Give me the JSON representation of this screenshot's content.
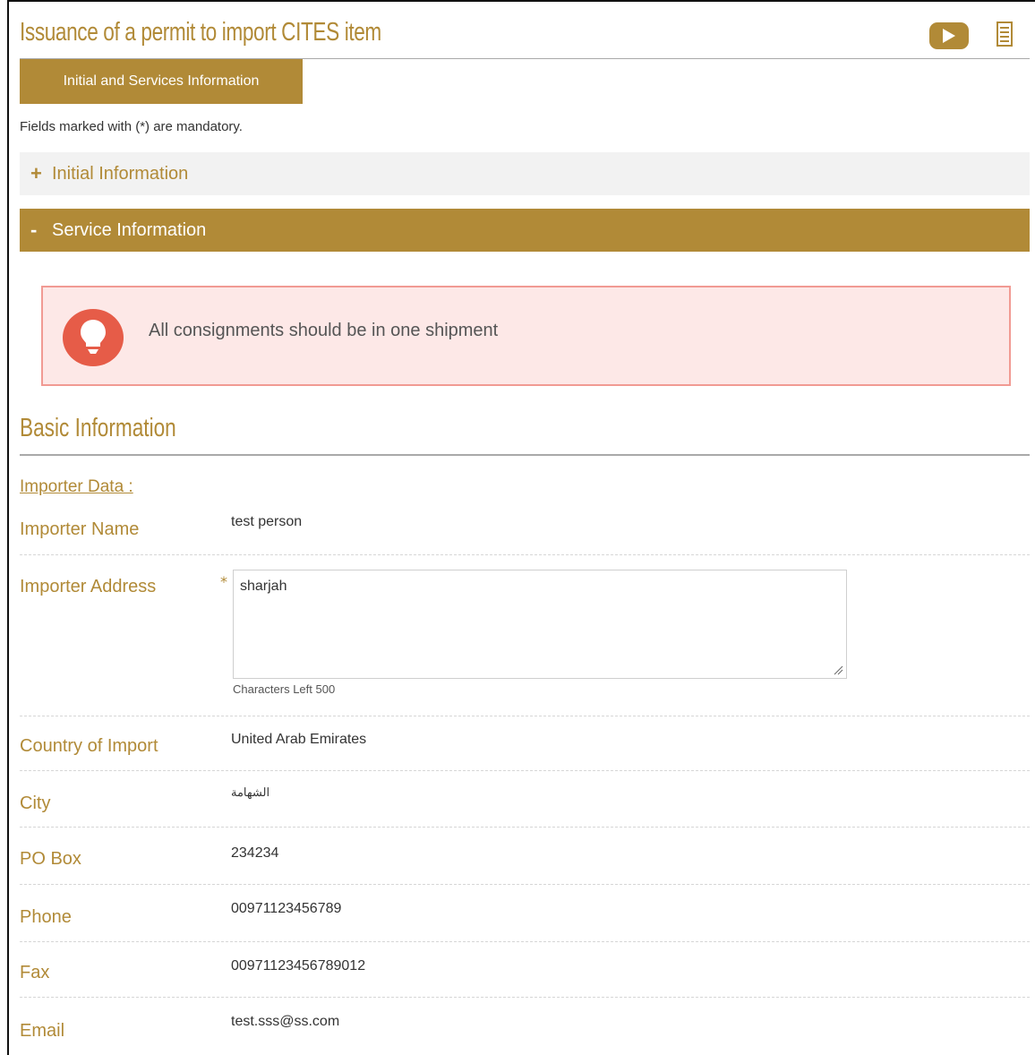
{
  "header": {
    "title": "Issuance of a permit to import CITES item",
    "icons": {
      "video": "play-video-icon",
      "document": "document-icon"
    }
  },
  "tabs": [
    {
      "label": "Initial and Services Information",
      "active": true
    }
  ],
  "form": {
    "mandatory_note": "Fields marked with (*) are mandatory."
  },
  "accordions": {
    "initial": {
      "sign": "+",
      "label": "Initial Information",
      "expanded": false
    },
    "service": {
      "sign": "-",
      "label": "Service Information",
      "expanded": true
    }
  },
  "notice": {
    "text": "All consignments should be in one shipment",
    "icon": "lightbulb-icon"
  },
  "basic_info": {
    "title": "Basic Information",
    "subheading": "Importer Data :",
    "fields": {
      "importer_name": {
        "label": "Importer Name",
        "value": "test person"
      },
      "importer_address": {
        "label": "Importer Address",
        "value": "sharjah",
        "required_mark": "*",
        "chars_left": "Characters Left 500"
      },
      "country": {
        "label": "Country of Import",
        "value": "United Arab Emirates"
      },
      "city": {
        "label": "City",
        "value": "الشهامة"
      },
      "po_box": {
        "label": "PO Box",
        "value": "234234"
      },
      "phone": {
        "label": "Phone",
        "value": "00971123456789"
      },
      "fax": {
        "label": "Fax",
        "value": "00971123456789012"
      },
      "email": {
        "label": "Email",
        "value": "test.sss@ss.com"
      }
    }
  },
  "colors": {
    "accent": "#b18a37",
    "notice_bg": "#fde8e7",
    "notice_border": "#f19a93",
    "notice_icon": "#e65c48"
  }
}
